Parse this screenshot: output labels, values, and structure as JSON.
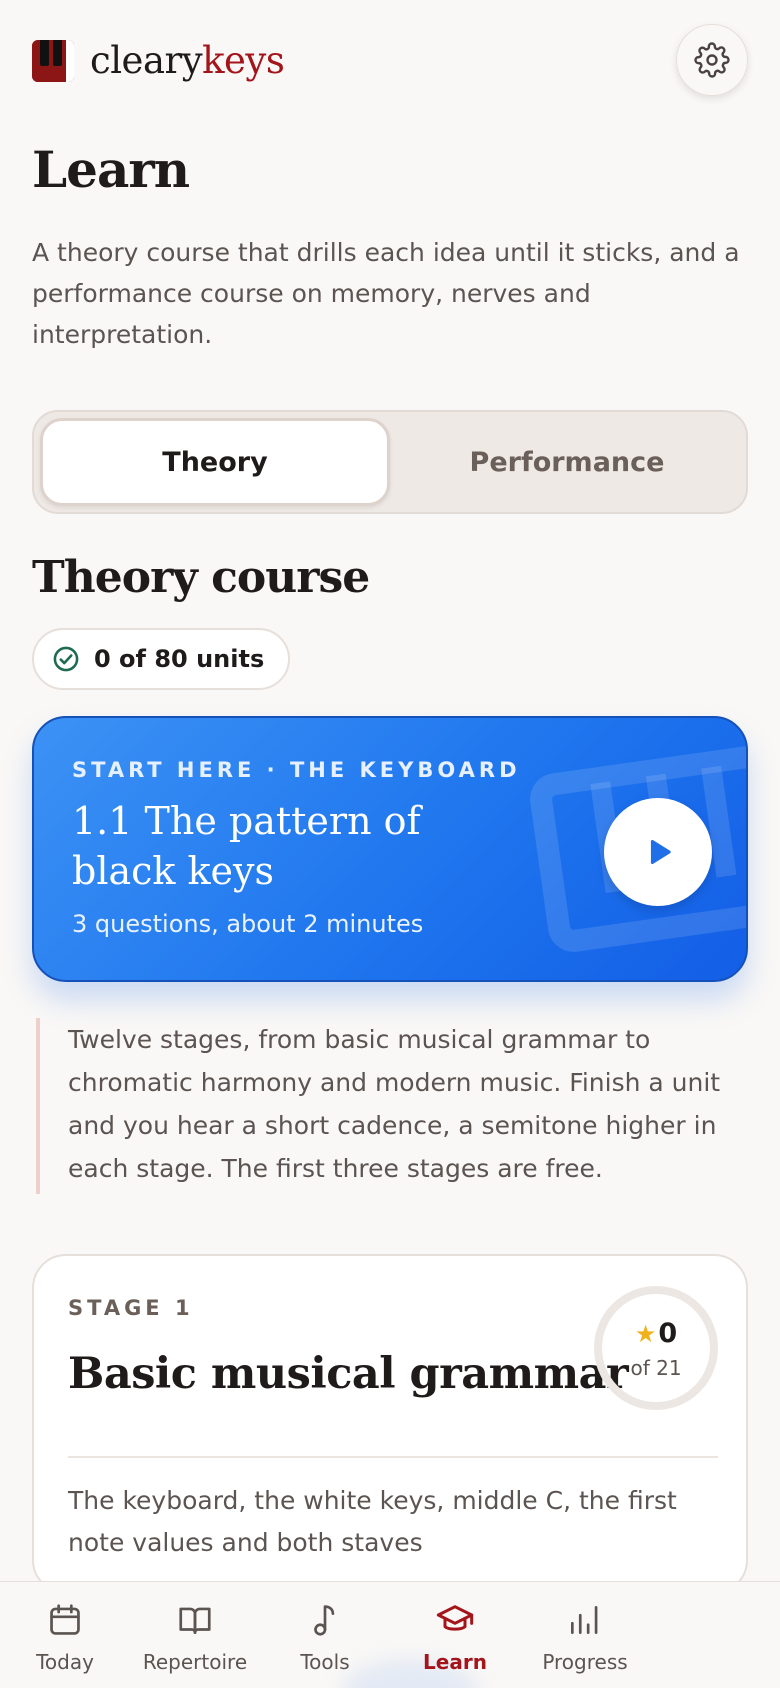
{
  "brand": {
    "name_part1": "cleary",
    "name_part2": "keys"
  },
  "header": {
    "settings_icon": "gear-icon"
  },
  "page": {
    "title": "Learn",
    "intro": "A theory course that drills each idea until it sticks, and a performance course on memory, nerves and interpretation."
  },
  "tabs": [
    {
      "label": "Theory",
      "active": true
    },
    {
      "label": "Performance",
      "active": false
    }
  ],
  "course": {
    "heading": "Theory course",
    "progress_label": "0 of 80 units",
    "start_card": {
      "eyebrow": "START HERE · THE KEYBOARD",
      "title": "1.1 The pattern of black keys",
      "meta": "3 questions, about 2 minutes"
    },
    "note": "Twelve stages, from basic musical grammar to chromatic harmony and modern music. Finish a unit and you hear a short cadence, a semitone higher in each stage. The first three stages are free."
  },
  "stage": {
    "eyebrow": "STAGE 1",
    "title": "Basic musical grammar",
    "stars": "0",
    "of_total": "of 21",
    "description": "The keyboard, the white keys, middle C, the first note values and both staves"
  },
  "nav": [
    {
      "label": "Today",
      "icon": "calendar-icon",
      "active": false
    },
    {
      "label": "Repertoire",
      "icon": "book-icon",
      "active": false
    },
    {
      "label": "Tools",
      "icon": "music-note-icon",
      "active": false
    },
    {
      "label": "Learn",
      "icon": "graduation-cap-icon",
      "active": true
    },
    {
      "label": "Progress",
      "icon": "bar-chart-icon",
      "active": false
    }
  ],
  "colors": {
    "brand_red": "#a3141b",
    "accent_blue": "#1f76ee",
    "success_green": "#1f6b4f",
    "star_gold": "#f0b21c"
  }
}
